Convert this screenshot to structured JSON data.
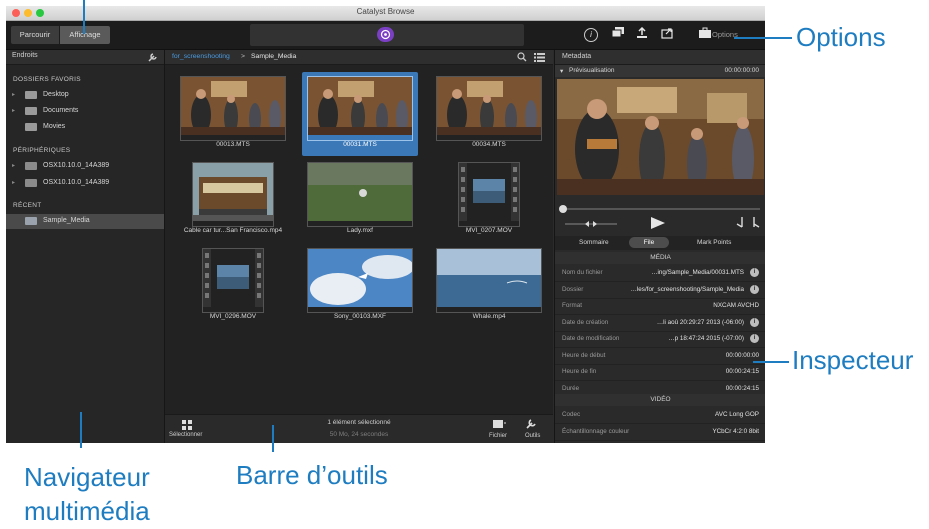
{
  "window": {
    "title": "Catalyst Browse"
  },
  "toolbar": {
    "tab_browse": "Parcourir",
    "tab_view": "Affichage",
    "options_label": "Options"
  },
  "sidebar": {
    "header": "Endroits",
    "favorites_title": "DOSSIERS FAVORIS",
    "favorites": [
      "Desktop",
      "Documents",
      "Movies"
    ],
    "devices_title": "PÉRIPHÉRIQUES",
    "devices": [
      "OSX10.10.0_14A389",
      "OSX10.10.0_14A389"
    ],
    "recent_title": "RÉCENT",
    "recent": [
      "Sample_Media"
    ]
  },
  "breadcrumb": {
    "parent": "for_screenshooting",
    "current": "Sample_Media"
  },
  "media": [
    {
      "name": "00013.MTS",
      "kind": "concert"
    },
    {
      "name": "00031.MTS",
      "kind": "concert",
      "selected": true
    },
    {
      "name": "00034.MTS",
      "kind": "concert"
    },
    {
      "name": "Cable car tur...San Francisco.mp4",
      "kind": "tram"
    },
    {
      "name": "Lady.mxf",
      "kind": "field"
    },
    {
      "name": "MVI_0207.MOV",
      "kind": "film"
    },
    {
      "name": "MVI_0296.MOV",
      "kind": "film"
    },
    {
      "name": "Sony_00103.MXF",
      "kind": "sky"
    },
    {
      "name": "Whale.mp4",
      "kind": "sea"
    }
  ],
  "bottombar": {
    "select_label": "Sélectionner",
    "status_line1": "1 élément sélectionné",
    "status_line2": "50 Mo, 24 secondes",
    "file_label": "Fichier",
    "tools_label": "Outils"
  },
  "inspector": {
    "header": "Metadata",
    "preview_label": "Prévisualisation",
    "preview_time": "00:00:00:00",
    "tabs": [
      "Sommaire",
      "File",
      "Mark Points"
    ],
    "media_section": "MÉDIA",
    "rows": [
      {
        "k": "Nom du fichier",
        "v": "…ing/Sample_Media/00031.MTS",
        "info": true
      },
      {
        "k": "Dossier",
        "v": "…les/for_screenshooting/Sample_Media",
        "info": true
      },
      {
        "k": "Format",
        "v": "NXCAM AVCHD",
        "info": false
      },
      {
        "k": "Date de création",
        "v": "…li aoû 20:29:27 2013 (-06:00)",
        "info": true
      },
      {
        "k": "Date de modification",
        "v": "…p 18:47:24 2015 (-07:00)",
        "info": true
      },
      {
        "k": "Heure de début",
        "v": "00:00:00:00",
        "info": false
      },
      {
        "k": "Heure de fin",
        "v": "00:00:24:15",
        "info": false
      },
      {
        "k": "Durée",
        "v": "00:00:24:15",
        "info": false
      }
    ],
    "video_section": "VIDÉO",
    "video_rows": [
      {
        "k": "Codec",
        "v": "AVC Long GOP",
        "info": false
      },
      {
        "k": "Échantillonnage couleur",
        "v": "YCbCr 4:2:0 8bit",
        "info": false
      }
    ]
  },
  "callouts": {
    "options": "Options",
    "inspector": "Inspecteur",
    "navigator_line1": "Navigateur",
    "navigator_line2": "multimédia",
    "toolbar": "Barre d’outils"
  },
  "colors": {
    "accent": "#1e7dc1",
    "selection": "#3a78b8",
    "window_bg": "#2b2b2b"
  }
}
